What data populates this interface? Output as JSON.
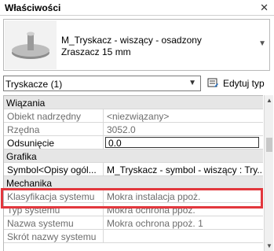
{
  "panel": {
    "title": "Właściwości",
    "close_glyph": "✕"
  },
  "preview": {
    "family": "M_Tryskacz - wiszący - osadzony",
    "type": "Zraszacz 15 mm"
  },
  "type_selector": {
    "value": "Tryskacze (1)"
  },
  "edit_type": {
    "label": "Edytuj typ",
    "icon": "edit-type-icon"
  },
  "groups": {
    "constraints": "Wiązania",
    "graphics": "Grafika",
    "mechanical": "Mechanika"
  },
  "rows": {
    "host": {
      "name": "Obiekt nadrzędny",
      "value": "<niezwiązany>"
    },
    "elevation": {
      "name": "Rzędna",
      "value": "3052.0"
    },
    "offset": {
      "name": "Odsunięcie",
      "value": "0.0"
    },
    "symbol": {
      "name": "Symbol<Opisy ogól...",
      "value": "M_Tryskacz - symbol - wiszący : Try..."
    },
    "system_class": {
      "name": "Klasyfikacja systemu",
      "value": "Mokra instalacja ppoż."
    },
    "system_type": {
      "name": "Typ systemu",
      "value": "Mokra ochrona ppoż."
    },
    "system_name": {
      "name": "Nazwa systemu",
      "value": "Mokra ochrona ppoż. 1"
    },
    "system_abbr": {
      "name": "Skrót nazwy systemu",
      "value": ""
    }
  },
  "colors": {
    "highlight": "#e2373d",
    "group_bg": "#e6e6e6"
  }
}
